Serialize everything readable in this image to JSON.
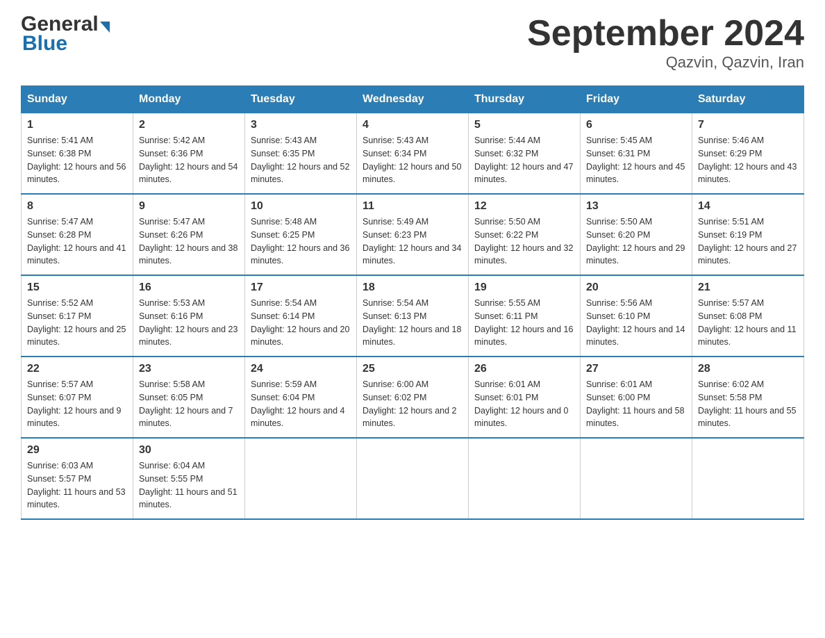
{
  "header": {
    "logo_general": "General",
    "logo_blue": "Blue",
    "month_title": "September 2024",
    "location": "Qazvin, Qazvin, Iran"
  },
  "days_of_week": [
    "Sunday",
    "Monday",
    "Tuesday",
    "Wednesday",
    "Thursday",
    "Friday",
    "Saturday"
  ],
  "weeks": [
    [
      {
        "day": "1",
        "sunrise": "5:41 AM",
        "sunset": "6:38 PM",
        "daylight": "12 hours and 56 minutes."
      },
      {
        "day": "2",
        "sunrise": "5:42 AM",
        "sunset": "6:36 PM",
        "daylight": "12 hours and 54 minutes."
      },
      {
        "day": "3",
        "sunrise": "5:43 AM",
        "sunset": "6:35 PM",
        "daylight": "12 hours and 52 minutes."
      },
      {
        "day": "4",
        "sunrise": "5:43 AM",
        "sunset": "6:34 PM",
        "daylight": "12 hours and 50 minutes."
      },
      {
        "day": "5",
        "sunrise": "5:44 AM",
        "sunset": "6:32 PM",
        "daylight": "12 hours and 47 minutes."
      },
      {
        "day": "6",
        "sunrise": "5:45 AM",
        "sunset": "6:31 PM",
        "daylight": "12 hours and 45 minutes."
      },
      {
        "day": "7",
        "sunrise": "5:46 AM",
        "sunset": "6:29 PM",
        "daylight": "12 hours and 43 minutes."
      }
    ],
    [
      {
        "day": "8",
        "sunrise": "5:47 AM",
        "sunset": "6:28 PM",
        "daylight": "12 hours and 41 minutes."
      },
      {
        "day": "9",
        "sunrise": "5:47 AM",
        "sunset": "6:26 PM",
        "daylight": "12 hours and 38 minutes."
      },
      {
        "day": "10",
        "sunrise": "5:48 AM",
        "sunset": "6:25 PM",
        "daylight": "12 hours and 36 minutes."
      },
      {
        "day": "11",
        "sunrise": "5:49 AM",
        "sunset": "6:23 PM",
        "daylight": "12 hours and 34 minutes."
      },
      {
        "day": "12",
        "sunrise": "5:50 AM",
        "sunset": "6:22 PM",
        "daylight": "12 hours and 32 minutes."
      },
      {
        "day": "13",
        "sunrise": "5:50 AM",
        "sunset": "6:20 PM",
        "daylight": "12 hours and 29 minutes."
      },
      {
        "day": "14",
        "sunrise": "5:51 AM",
        "sunset": "6:19 PM",
        "daylight": "12 hours and 27 minutes."
      }
    ],
    [
      {
        "day": "15",
        "sunrise": "5:52 AM",
        "sunset": "6:17 PM",
        "daylight": "12 hours and 25 minutes."
      },
      {
        "day": "16",
        "sunrise": "5:53 AM",
        "sunset": "6:16 PM",
        "daylight": "12 hours and 23 minutes."
      },
      {
        "day": "17",
        "sunrise": "5:54 AM",
        "sunset": "6:14 PM",
        "daylight": "12 hours and 20 minutes."
      },
      {
        "day": "18",
        "sunrise": "5:54 AM",
        "sunset": "6:13 PM",
        "daylight": "12 hours and 18 minutes."
      },
      {
        "day": "19",
        "sunrise": "5:55 AM",
        "sunset": "6:11 PM",
        "daylight": "12 hours and 16 minutes."
      },
      {
        "day": "20",
        "sunrise": "5:56 AM",
        "sunset": "6:10 PM",
        "daylight": "12 hours and 14 minutes."
      },
      {
        "day": "21",
        "sunrise": "5:57 AM",
        "sunset": "6:08 PM",
        "daylight": "12 hours and 11 minutes."
      }
    ],
    [
      {
        "day": "22",
        "sunrise": "5:57 AM",
        "sunset": "6:07 PM",
        "daylight": "12 hours and 9 minutes."
      },
      {
        "day": "23",
        "sunrise": "5:58 AM",
        "sunset": "6:05 PM",
        "daylight": "12 hours and 7 minutes."
      },
      {
        "day": "24",
        "sunrise": "5:59 AM",
        "sunset": "6:04 PM",
        "daylight": "12 hours and 4 minutes."
      },
      {
        "day": "25",
        "sunrise": "6:00 AM",
        "sunset": "6:02 PM",
        "daylight": "12 hours and 2 minutes."
      },
      {
        "day": "26",
        "sunrise": "6:01 AM",
        "sunset": "6:01 PM",
        "daylight": "12 hours and 0 minutes."
      },
      {
        "day": "27",
        "sunrise": "6:01 AM",
        "sunset": "6:00 PM",
        "daylight": "11 hours and 58 minutes."
      },
      {
        "day": "28",
        "sunrise": "6:02 AM",
        "sunset": "5:58 PM",
        "daylight": "11 hours and 55 minutes."
      }
    ],
    [
      {
        "day": "29",
        "sunrise": "6:03 AM",
        "sunset": "5:57 PM",
        "daylight": "11 hours and 53 minutes."
      },
      {
        "day": "30",
        "sunrise": "6:04 AM",
        "sunset": "5:55 PM",
        "daylight": "11 hours and 51 minutes."
      },
      null,
      null,
      null,
      null,
      null
    ]
  ],
  "labels": {
    "sunrise_prefix": "Sunrise: ",
    "sunset_prefix": "Sunset: ",
    "daylight_prefix": "Daylight: "
  }
}
